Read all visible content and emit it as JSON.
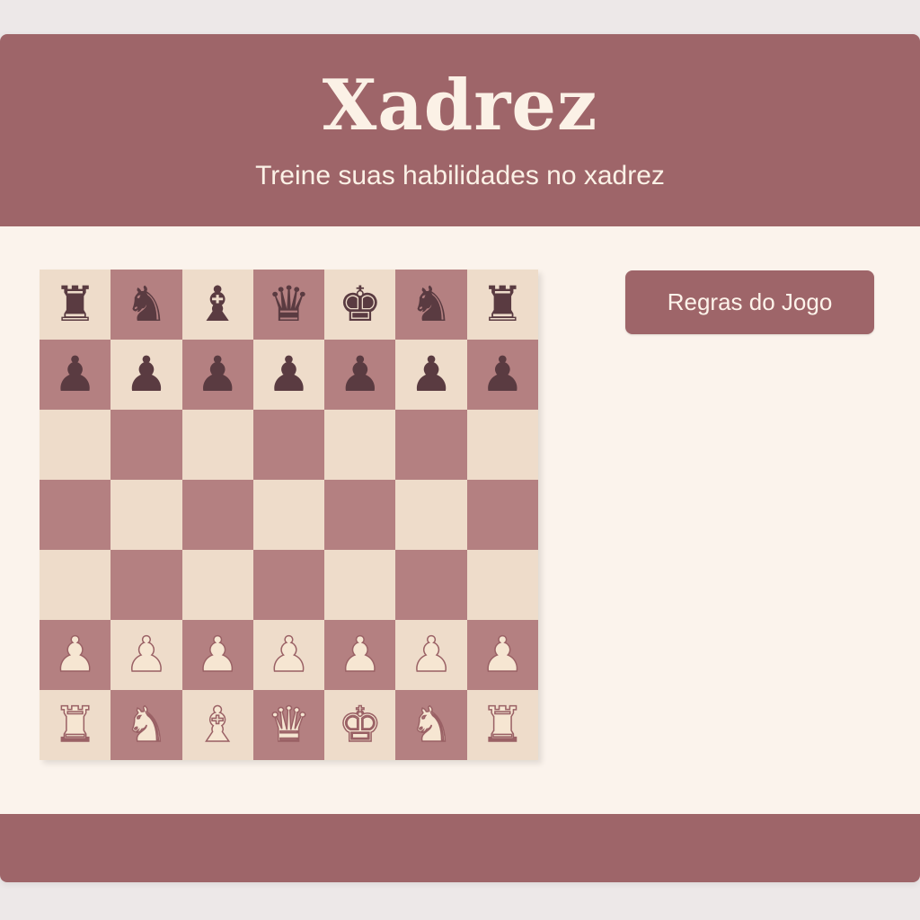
{
  "header": {
    "title": "Xadrez",
    "subtitle": "Treine suas habilidades no xadrez"
  },
  "actions": {
    "rules_label": "Regras do Jogo"
  },
  "colors": {
    "brand": "#9e6569",
    "light_square": "#eedcca",
    "dark_square": "#b48081",
    "black_piece": "#5a3b41",
    "white_piece": "#f6e6d2",
    "page_background": "#fbf3ec"
  },
  "board": {
    "rows": [
      [
        "black-rook",
        "black-knight",
        "black-bishop",
        "black-queen",
        "black-king",
        "black-knight",
        "black-rook"
      ],
      [
        "black-pawn",
        "black-pawn",
        "black-pawn",
        "black-pawn",
        "black-pawn",
        "black-pawn",
        "black-pawn"
      ],
      [
        "",
        "",
        "",
        "",
        "",
        "",
        ""
      ],
      [
        "",
        "",
        "",
        "",
        "",
        "",
        ""
      ],
      [
        "",
        "",
        "",
        "",
        "",
        "",
        ""
      ],
      [
        "white-pawn",
        "white-pawn",
        "white-pawn",
        "white-pawn",
        "white-pawn",
        "white-pawn",
        "white-pawn"
      ],
      [
        "white-rook",
        "white-knight",
        "white-bishop",
        "white-queen",
        "white-king",
        "white-knight",
        "white-rook"
      ]
    ]
  }
}
